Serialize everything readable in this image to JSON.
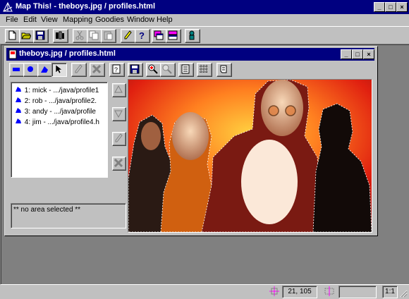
{
  "app": {
    "title": "Map This! - theboys.jpg / profiles.html",
    "caption_buttons": [
      "_",
      "□",
      "×"
    ]
  },
  "menu": [
    "File",
    "Edit",
    "View",
    "Mapping",
    "Goodies",
    "Window",
    "Help"
  ],
  "toolbar": {
    "icons": [
      "new-icon",
      "open-icon",
      "save-icon",
      "map-properties-icon",
      "cut-icon",
      "copy-icon",
      "paste-icon",
      "edit-icon",
      "help-icon",
      "cascade-windows-icon",
      "tile-windows-icon",
      "info-icon"
    ]
  },
  "child": {
    "title": "theboys.jpg / profiles.html",
    "caption_buttons": [
      "_",
      "□",
      "×"
    ],
    "tools": [
      "rectangle-tool-icon",
      "circle-tool-icon",
      "polygon-tool-icon",
      "pointer-tool-icon",
      "pencil-tool-icon",
      "delete-area-icon",
      "area-info-icon",
      "save-icon",
      "zoom-in-icon",
      "zoom-out-icon",
      "document-icon",
      "grid-icon",
      "scroll-icon"
    ]
  },
  "areas": [
    {
      "label": "1: mick - .../java/profile1"
    },
    {
      "label": "2: rob - .../java/profile2."
    },
    {
      "label": "3: andy - .../java/profile"
    },
    {
      "label": "4: jim - .../java/profile4.h"
    }
  ],
  "side_buttons": [
    "move-up-icon",
    "move-down-icon",
    "edit-area-icon",
    "delete-area-icon"
  ],
  "selection_info": "** no area selected **",
  "status": {
    "coordinates": "21, 105",
    "zoom": "1:1"
  }
}
